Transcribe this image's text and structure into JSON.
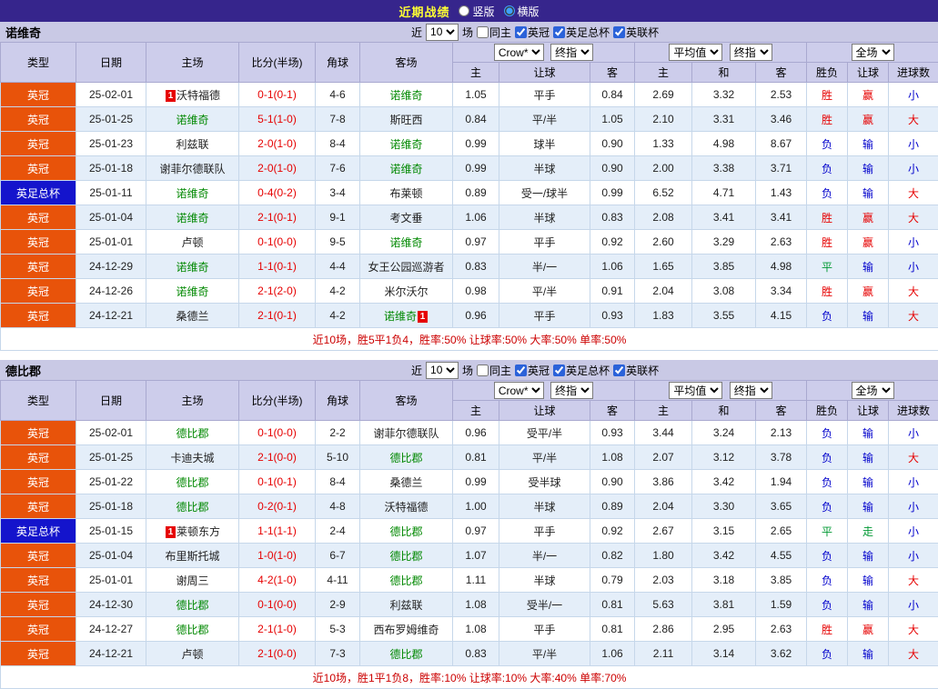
{
  "topbar": {
    "title": "近期战绩",
    "options": [
      {
        "label": "竖版",
        "selected": false
      },
      {
        "label": "横版",
        "selected": true
      }
    ]
  },
  "filters": {
    "near_label": "近",
    "count": "10",
    "games_label": "场",
    "same_home_label": "同主",
    "same_home_checked": false,
    "leagues": [
      "英冠",
      "英足总杯",
      "英联杯"
    ],
    "leagues_checked": [
      true,
      true,
      true
    ]
  },
  "table_header": {
    "cols": [
      "类型",
      "日期",
      "主场",
      "比分(半场)",
      "角球",
      "客场"
    ],
    "ah_company": "Crow*",
    "ah_stage": "终指",
    "eu_company": "平均值",
    "eu_stage": "终指",
    "result_scope": "全场",
    "sub": [
      "主",
      "让球",
      "客",
      "主",
      "和",
      "客",
      "胜负",
      "让球",
      "进球数"
    ]
  },
  "league_colors": {
    "英冠": "#e8530a",
    "英足总杯": "#1414cc"
  },
  "result_colors": {
    "胜": "#e60000",
    "负": "#0000cc",
    "平": "#009933",
    "赢": "#e60000",
    "输": "#0000cc",
    "走": "#009933",
    "大": "#e60000",
    "小": "#0000cc"
  },
  "sections": [
    {
      "team": "诺维奇",
      "summary": "近10场，胜5平1负4，胜率:50% 让球率:50% 大率:50% 单率:50%",
      "rows": [
        {
          "type": "英冠",
          "date": "25-02-01",
          "home": {
            "name": "沃特福德",
            "badge": "1",
            "badge_pos": "before"
          },
          "score": "0-1(0-1)",
          "corner": "4-6",
          "away": {
            "name": "诺维奇",
            "focus": true
          },
          "ah": [
            "1.05",
            "平手",
            "0.84"
          ],
          "eu": [
            "2.69",
            "3.32",
            "2.53"
          ],
          "res": [
            "胜",
            "赢",
            "小"
          ]
        },
        {
          "type": "英冠",
          "date": "25-01-25",
          "home": {
            "name": "诺维奇",
            "focus": true
          },
          "score": "5-1(1-0)",
          "corner": "7-8",
          "away": {
            "name": "斯旺西"
          },
          "ah": [
            "0.84",
            "平/半",
            "1.05"
          ],
          "eu": [
            "2.10",
            "3.31",
            "3.46"
          ],
          "res": [
            "胜",
            "赢",
            "大"
          ]
        },
        {
          "type": "英冠",
          "date": "25-01-23",
          "home": {
            "name": "利兹联"
          },
          "score": "2-0(1-0)",
          "corner": "8-4",
          "away": {
            "name": "诺维奇",
            "focus": true
          },
          "ah": [
            "0.99",
            "球半",
            "0.90"
          ],
          "eu": [
            "1.33",
            "4.98",
            "8.67"
          ],
          "res": [
            "负",
            "输",
            "小"
          ]
        },
        {
          "type": "英冠",
          "date": "25-01-18",
          "home": {
            "name": "谢菲尔德联队"
          },
          "score": "2-0(1-0)",
          "corner": "7-6",
          "away": {
            "name": "诺维奇",
            "focus": true
          },
          "ah": [
            "0.99",
            "半球",
            "0.90"
          ],
          "eu": [
            "2.00",
            "3.38",
            "3.71"
          ],
          "res": [
            "负",
            "输",
            "小"
          ]
        },
        {
          "type": "英足总杯",
          "date": "25-01-11",
          "home": {
            "name": "诺维奇",
            "focus": true
          },
          "score": "0-4(0-2)",
          "corner": "3-4",
          "away": {
            "name": "布莱顿"
          },
          "ah": [
            "0.89",
            "受一/球半",
            "0.99"
          ],
          "eu": [
            "6.52",
            "4.71",
            "1.43"
          ],
          "res": [
            "负",
            "输",
            "大"
          ]
        },
        {
          "type": "英冠",
          "date": "25-01-04",
          "home": {
            "name": "诺维奇",
            "focus": true
          },
          "score": "2-1(0-1)",
          "corner": "9-1",
          "away": {
            "name": "考文垂"
          },
          "ah": [
            "1.06",
            "半球",
            "0.83"
          ],
          "eu": [
            "2.08",
            "3.41",
            "3.41"
          ],
          "res": [
            "胜",
            "赢",
            "大"
          ]
        },
        {
          "type": "英冠",
          "date": "25-01-01",
          "home": {
            "name": "卢顿"
          },
          "score": "0-1(0-0)",
          "corner": "9-5",
          "away": {
            "name": "诺维奇",
            "focus": true
          },
          "ah": [
            "0.97",
            "平手",
            "0.92"
          ],
          "eu": [
            "2.60",
            "3.29",
            "2.63"
          ],
          "res": [
            "胜",
            "赢",
            "小"
          ]
        },
        {
          "type": "英冠",
          "date": "24-12-29",
          "home": {
            "name": "诺维奇",
            "focus": true
          },
          "score": "1-1(0-1)",
          "corner": "4-4",
          "away": {
            "name": "女王公园巡游者"
          },
          "ah": [
            "0.83",
            "半/一",
            "1.06"
          ],
          "eu": [
            "1.65",
            "3.85",
            "4.98"
          ],
          "res": [
            "平",
            "输",
            "小"
          ]
        },
        {
          "type": "英冠",
          "date": "24-12-26",
          "home": {
            "name": "诺维奇",
            "focus": true
          },
          "score": "2-1(2-0)",
          "corner": "4-2",
          "away": {
            "name": "米尔沃尔"
          },
          "ah": [
            "0.98",
            "平/半",
            "0.91"
          ],
          "eu": [
            "2.04",
            "3.08",
            "3.34"
          ],
          "res": [
            "胜",
            "赢",
            "大"
          ]
        },
        {
          "type": "英冠",
          "date": "24-12-21",
          "home": {
            "name": "桑德兰"
          },
          "score": "2-1(0-1)",
          "corner": "4-2",
          "away": {
            "name": "诺维奇",
            "focus": true,
            "badge": "1",
            "badge_pos": "after"
          },
          "ah": [
            "0.96",
            "平手",
            "0.93"
          ],
          "eu": [
            "1.83",
            "3.55",
            "4.15"
          ],
          "res": [
            "负",
            "输",
            "大"
          ]
        }
      ]
    },
    {
      "team": "德比郡",
      "summary": "近10场，胜1平1负8，胜率:10% 让球率:10% 大率:40% 单率:70%",
      "rows": [
        {
          "type": "英冠",
          "date": "25-02-01",
          "home": {
            "name": "德比郡",
            "focus": true
          },
          "score": "0-1(0-0)",
          "corner": "2-2",
          "away": {
            "name": "谢菲尔德联队"
          },
          "ah": [
            "0.96",
            "受平/半",
            "0.93"
          ],
          "eu": [
            "3.44",
            "3.24",
            "2.13"
          ],
          "res": [
            "负",
            "输",
            "小"
          ]
        },
        {
          "type": "英冠",
          "date": "25-01-25",
          "home": {
            "name": "卡迪夫城"
          },
          "score": "2-1(0-0)",
          "corner": "5-10",
          "away": {
            "name": "德比郡",
            "focus": true
          },
          "ah": [
            "0.81",
            "平/半",
            "1.08"
          ],
          "eu": [
            "2.07",
            "3.12",
            "3.78"
          ],
          "res": [
            "负",
            "输",
            "大"
          ]
        },
        {
          "type": "英冠",
          "date": "25-01-22",
          "home": {
            "name": "德比郡",
            "focus": true
          },
          "score": "0-1(0-1)",
          "corner": "8-4",
          "away": {
            "name": "桑德兰"
          },
          "ah": [
            "0.99",
            "受半球",
            "0.90"
          ],
          "eu": [
            "3.86",
            "3.42",
            "1.94"
          ],
          "res": [
            "负",
            "输",
            "小"
          ]
        },
        {
          "type": "英冠",
          "date": "25-01-18",
          "home": {
            "name": "德比郡",
            "focus": true
          },
          "score": "0-2(0-1)",
          "corner": "4-8",
          "away": {
            "name": "沃特福德"
          },
          "ah": [
            "1.00",
            "半球",
            "0.89"
          ],
          "eu": [
            "2.04",
            "3.30",
            "3.65"
          ],
          "res": [
            "负",
            "输",
            "小"
          ]
        },
        {
          "type": "英足总杯",
          "date": "25-01-15",
          "home": {
            "name": "莱顿东方",
            "badge": "1",
            "badge_pos": "before"
          },
          "score": "1-1(1-1)",
          "corner": "2-4",
          "away": {
            "name": "德比郡",
            "focus": true
          },
          "ah": [
            "0.97",
            "平手",
            "0.92"
          ],
          "eu": [
            "2.67",
            "3.15",
            "2.65"
          ],
          "res": [
            "平",
            "走",
            "小"
          ]
        },
        {
          "type": "英冠",
          "date": "25-01-04",
          "home": {
            "name": "布里斯托城"
          },
          "score": "1-0(1-0)",
          "corner": "6-7",
          "away": {
            "name": "德比郡",
            "focus": true
          },
          "ah": [
            "1.07",
            "半/一",
            "0.82"
          ],
          "eu": [
            "1.80",
            "3.42",
            "4.55"
          ],
          "res": [
            "负",
            "输",
            "小"
          ]
        },
        {
          "type": "英冠",
          "date": "25-01-01",
          "home": {
            "name": "谢周三"
          },
          "score": "4-2(1-0)",
          "corner": "4-11",
          "away": {
            "name": "德比郡",
            "focus": true
          },
          "ah": [
            "1.11",
            "半球",
            "0.79"
          ],
          "eu": [
            "2.03",
            "3.18",
            "3.85"
          ],
          "res": [
            "负",
            "输",
            "大"
          ]
        },
        {
          "type": "英冠",
          "date": "24-12-30",
          "home": {
            "name": "德比郡",
            "focus": true
          },
          "score": "0-1(0-0)",
          "corner": "2-9",
          "away": {
            "name": "利兹联"
          },
          "ah": [
            "1.08",
            "受半/一",
            "0.81"
          ],
          "eu": [
            "5.63",
            "3.81",
            "1.59"
          ],
          "res": [
            "负",
            "输",
            "小"
          ]
        },
        {
          "type": "英冠",
          "date": "24-12-27",
          "home": {
            "name": "德比郡",
            "focus": true
          },
          "score": "2-1(1-0)",
          "corner": "5-3",
          "away": {
            "name": "西布罗姆维奇"
          },
          "ah": [
            "1.08",
            "平手",
            "0.81"
          ],
          "eu": [
            "2.86",
            "2.95",
            "2.63"
          ],
          "res": [
            "胜",
            "赢",
            "大"
          ]
        },
        {
          "type": "英冠",
          "date": "24-12-21",
          "home": {
            "name": "卢顿"
          },
          "score": "2-1(0-0)",
          "corner": "7-3",
          "away": {
            "name": "德比郡",
            "focus": true
          },
          "ah": [
            "0.83",
            "平/半",
            "1.06"
          ],
          "eu": [
            "2.11",
            "3.14",
            "3.62"
          ],
          "res": [
            "负",
            "输",
            "大"
          ]
        }
      ]
    }
  ]
}
